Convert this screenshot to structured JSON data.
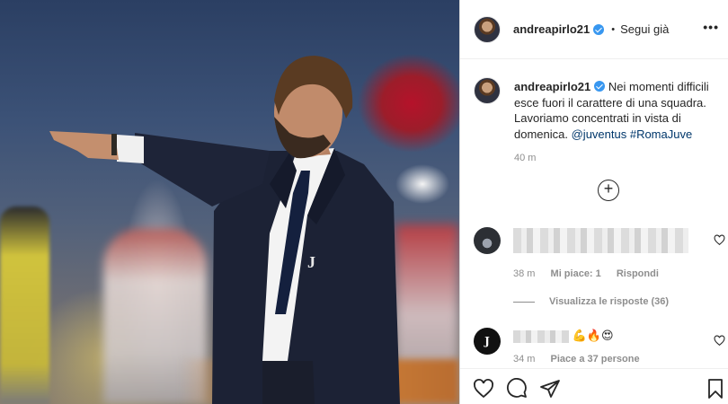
{
  "post": {
    "username": "andreapirlo21",
    "follow_status": "Segui già",
    "more_label": "•••",
    "caption_text": "Nei momenti difficili esce fuori il carattere di una squadra. Lavoriamo concentrati in vista di domenica.",
    "caption_mentions": "@juventus #RomaJuve",
    "caption_time": "40 m"
  },
  "comments": [
    {
      "username_hidden": true,
      "avatar_icon": "user-avatar",
      "time": "38 m",
      "likes": "Mi piace: 1",
      "reply_label": "Rispondi",
      "view_replies": "Visualizza le risposte (36)"
    },
    {
      "username_hidden": true,
      "avatar_label": "J",
      "avatar_sub": "juve",
      "emojis": "💪🔥😍",
      "time": "34 m",
      "likes": "Piace a 37 persone"
    }
  ],
  "icons": {
    "like": "heart-icon",
    "comment": "comment-icon",
    "share": "share-icon",
    "save": "bookmark-icon",
    "load_more": "plus-circle-icon"
  },
  "colors": {
    "verified": "#3897f0",
    "link": "#00376b",
    "muted": "#8e8e8e"
  }
}
